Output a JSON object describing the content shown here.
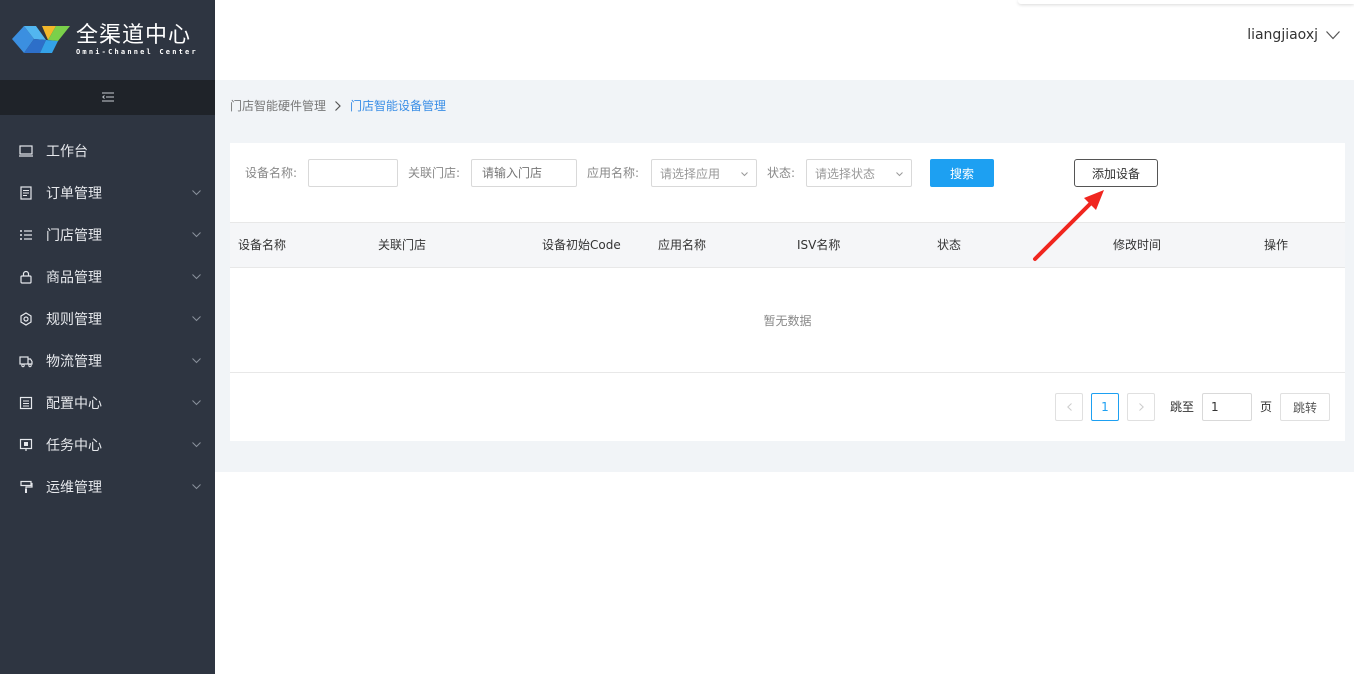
{
  "app": {
    "logo_cn": "全渠道中心",
    "logo_en": "Omni-Channel Center"
  },
  "header": {
    "username": "liangjiaoxj"
  },
  "sidebar": {
    "items": [
      {
        "label": "工作台",
        "icon": "monitor-icon",
        "has_arrow": false
      },
      {
        "label": "订单管理",
        "icon": "order-doc-icon",
        "has_arrow": true
      },
      {
        "label": "门店管理",
        "icon": "list-icon",
        "has_arrow": true
      },
      {
        "label": "商品管理",
        "icon": "lock-bag-icon",
        "has_arrow": true
      },
      {
        "label": "规则管理",
        "icon": "gear-icon",
        "has_arrow": true
      },
      {
        "label": "物流管理",
        "icon": "truck-icon",
        "has_arrow": true
      },
      {
        "label": "配置中心",
        "icon": "config-doc-icon",
        "has_arrow": true
      },
      {
        "label": "任务中心",
        "icon": "task-screen-icon",
        "has_arrow": true
      },
      {
        "label": "运维管理",
        "icon": "paint-roller-icon",
        "has_arrow": true
      }
    ]
  },
  "breadcrumb": {
    "parent": "门店智能硬件管理",
    "current": "门店智能设备管理"
  },
  "filters": {
    "device_name_label": "设备名称:",
    "device_name_value": "",
    "store_label": "关联门店:",
    "store_placeholder": "请输入门店",
    "app_label": "应用名称:",
    "app_placeholder": "请选择应用",
    "status_label": "状态:",
    "status_placeholder": "请选择状态",
    "search_label": "搜索",
    "add_label": "添加设备"
  },
  "table": {
    "columns": [
      "设备名称",
      "关联门店",
      "设备初始Code",
      "应用名称",
      "ISV名称",
      "状态",
      "修改时间",
      "操作"
    ],
    "empty_text": "暂无数据"
  },
  "pagination": {
    "current_page": "1",
    "jump_label": "跳至",
    "jump_value": "1",
    "page_unit": "页",
    "go_label": "跳转"
  },
  "colors": {
    "sidebar_bg": "#2e3541",
    "primary": "#1da0f2",
    "breadcrumb_active": "#3a8ee6",
    "annotation_arrow": "#f0261f"
  }
}
